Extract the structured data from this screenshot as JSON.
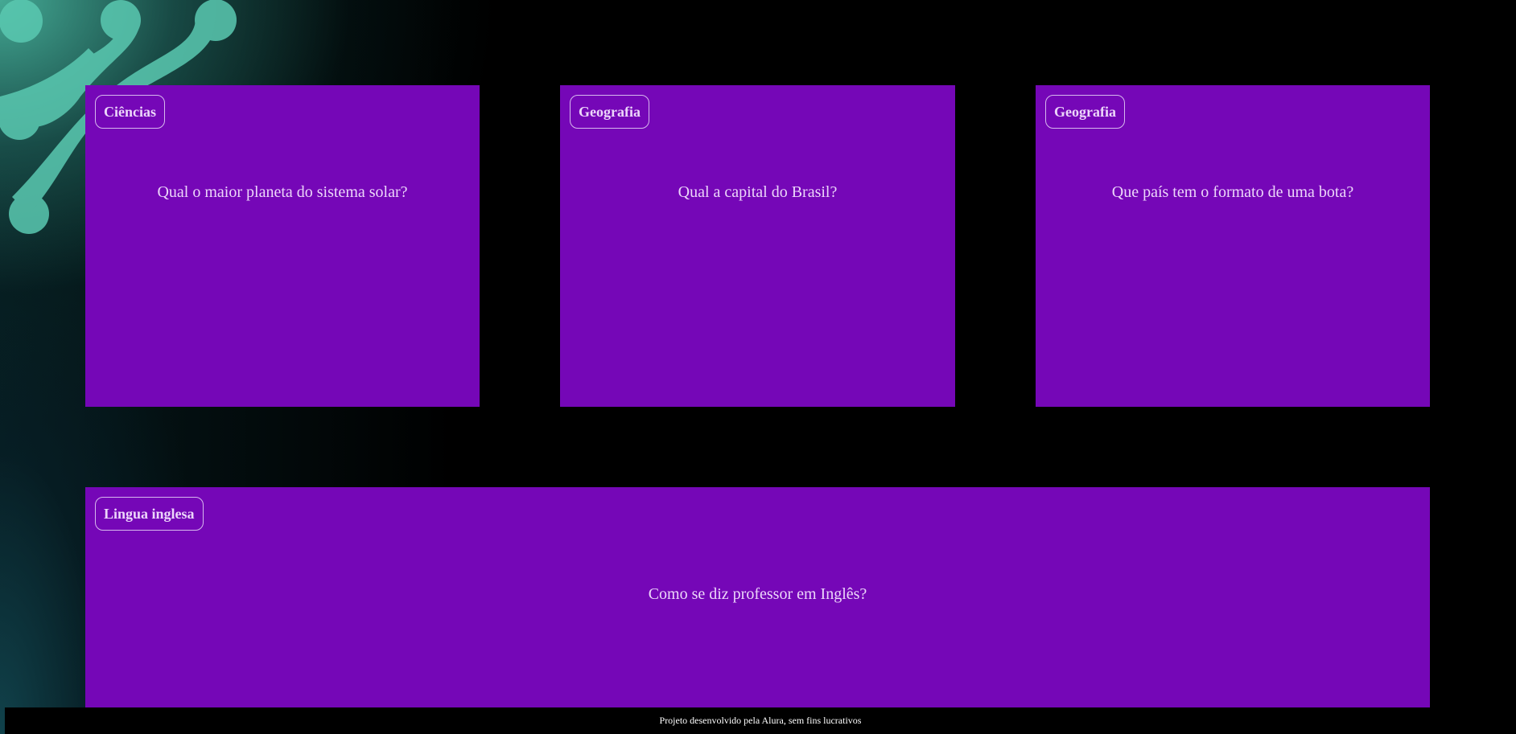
{
  "cards": [
    {
      "category": "Ciências",
      "question": "Qual o maior planeta do sistema solar?"
    },
    {
      "category": "Geografia",
      "question": "Qual a capital do Brasil?"
    },
    {
      "category": "Geografia",
      "question": "Que país tem o formato de uma bota?"
    },
    {
      "category": "Lingua inglesa",
      "question": "Como se diz professor em Inglês?"
    }
  ],
  "footer": {
    "text": "Projeto desenvolvido pela Alura, sem fins lucrativos"
  },
  "colors": {
    "background": "#000000",
    "card": "#7507b7",
    "card_text": "#ecd6fa",
    "decor_teal": "#4fc2a9"
  },
  "icons": {
    "background_decoration": "molecule-shape-icon"
  }
}
